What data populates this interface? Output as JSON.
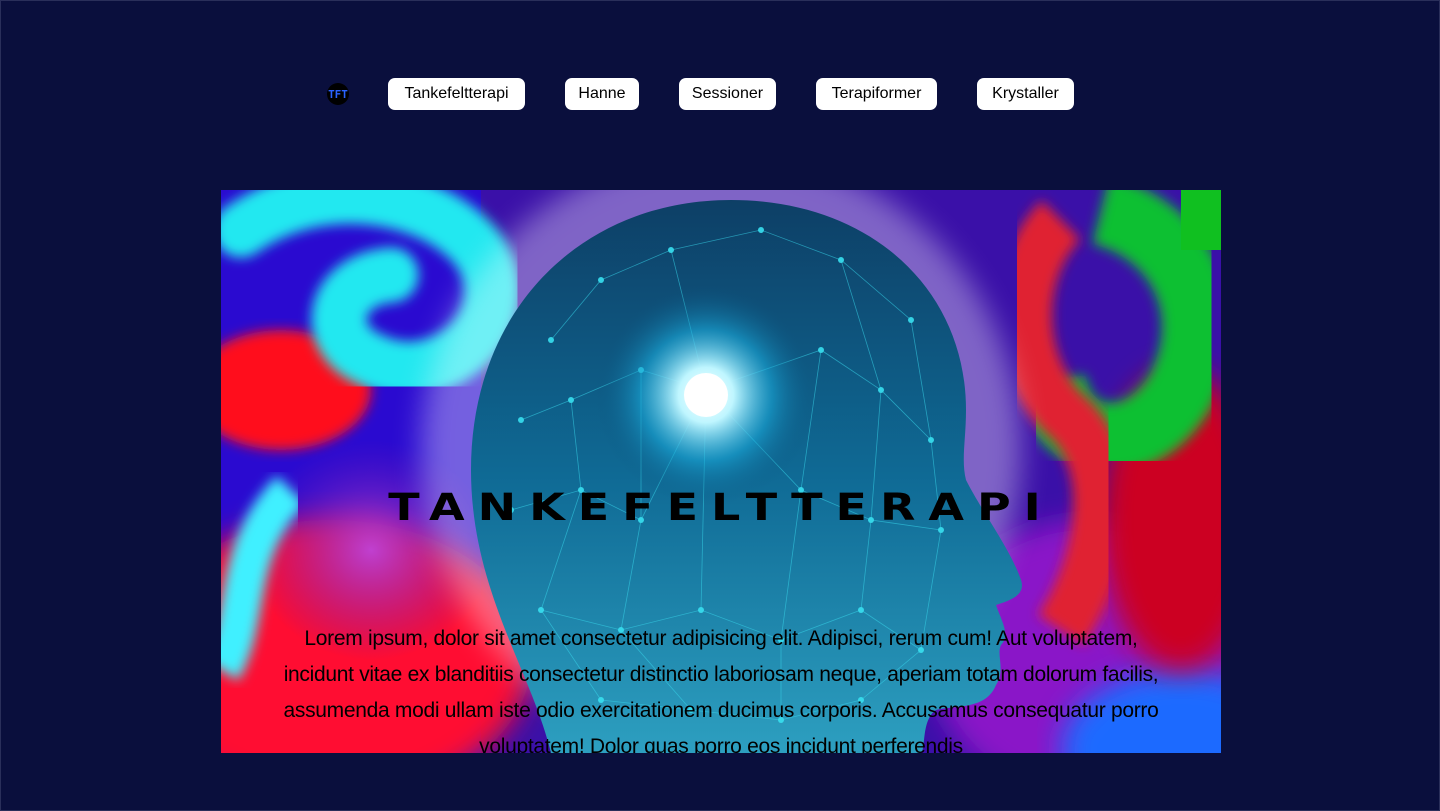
{
  "nav": {
    "logo_text": "TFT",
    "items": [
      {
        "label": "Tankefeltterapi"
      },
      {
        "label": "Hanne"
      },
      {
        "label": "Sessioner"
      },
      {
        "label": "Terapiformer"
      },
      {
        "label": "Krystaller"
      }
    ]
  },
  "hero": {
    "title": "Tankefeltterapi",
    "text": "Lorem ipsum, dolor sit amet consectetur adipisicing elit. Adipisci, rerum cum! Aut voluptatem, incidunt vitae ex blanditiis consectetur distinctio laboriosam neque, aperiam totam dolorum facilis, assumenda modi ullam iste odio exercitationem ducimus corporis. Accusamus consequatur porro voluptatem! Dolor quas porro eos incidunt perferendis"
  },
  "colors": {
    "page_background": "#0a0f3d",
    "nav_button_background": "#ffffff",
    "logo_text": "#2a63ff"
  }
}
